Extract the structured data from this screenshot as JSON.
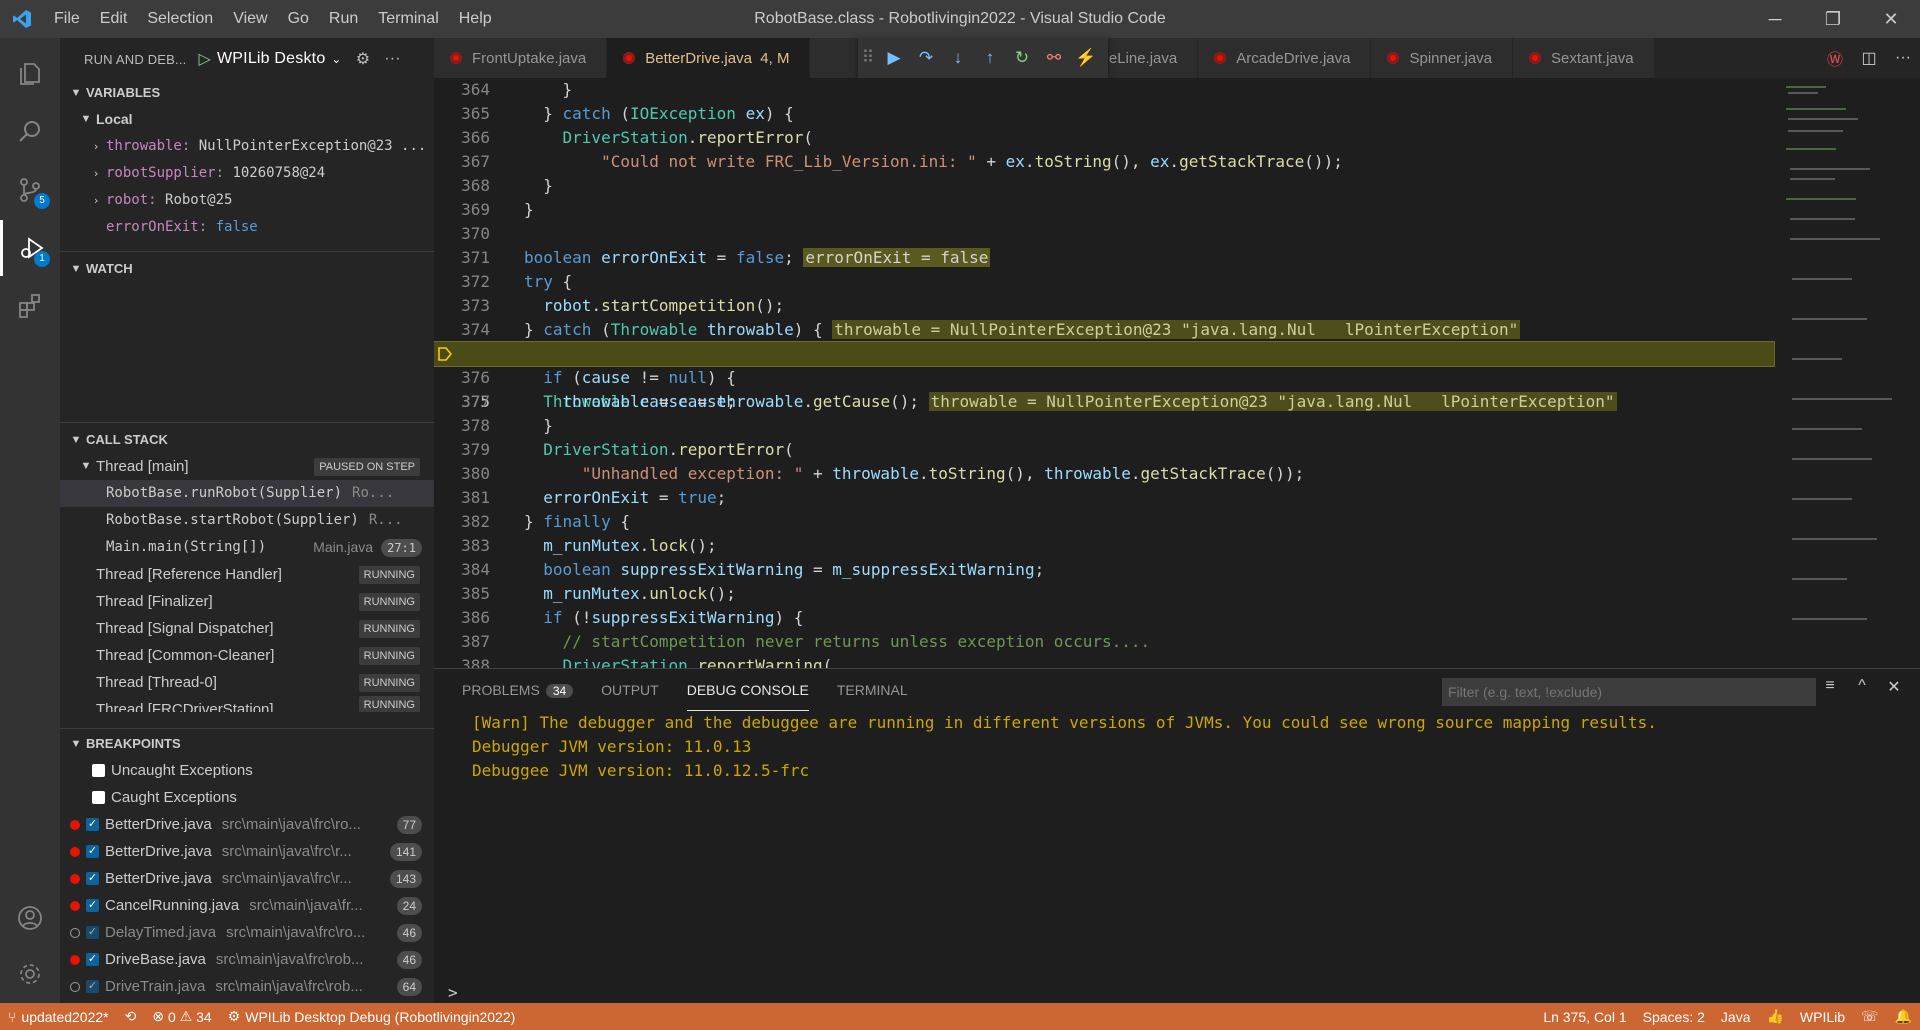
{
  "window": {
    "title": "RobotBase.class - Robotlivingin2022 - Visual Studio Code",
    "menu": [
      "File",
      "Edit",
      "Selection",
      "View",
      "Go",
      "Run",
      "Terminal",
      "Help"
    ],
    "controls": [
      "─",
      "❐",
      "✕"
    ]
  },
  "activity": {
    "scm_badge": "5",
    "debug_badge": "1"
  },
  "sidebar": {
    "title": "RUN AND DEB...",
    "config": "WPILib Deskto",
    "variables": {
      "header": "VARIABLES",
      "scope": "Local",
      "items": [
        {
          "name": "throwable:",
          "value": "NullPointerException@23 ..."
        },
        {
          "name": "robotSupplier:",
          "value": "10260758@24"
        },
        {
          "name": "robot:",
          "value": "Robot@25"
        },
        {
          "name": "errorOnExit:",
          "value": "false"
        }
      ]
    },
    "watch": {
      "header": "WATCH"
    },
    "callstack": {
      "header": "CALL STACK",
      "main_thread": "Thread [main]",
      "main_state": "PAUSED ON STEP",
      "frames": [
        {
          "name": "RobotBase.runRobot(Supplier)",
          "src": "Ro..."
        },
        {
          "name": "RobotBase.startRobot(Supplier)",
          "src": "R..."
        },
        {
          "name": "Main.main(String[])",
          "src": "Main.java",
          "pos": "27:1"
        }
      ],
      "threads": [
        {
          "name": "Thread [Reference Handler]",
          "state": "RUNNING"
        },
        {
          "name": "Thread [Finalizer]",
          "state": "RUNNING"
        },
        {
          "name": "Thread [Signal Dispatcher]",
          "state": "RUNNING"
        },
        {
          "name": "Thread [Common-Cleaner]",
          "state": "RUNNING"
        },
        {
          "name": "Thread [Thread-0]",
          "state": "RUNNING"
        },
        {
          "name": "Thread [FRCDriverStation]",
          "state": "RUNNING"
        }
      ]
    },
    "breakpoints": {
      "header": "BREAKPOINTS",
      "uncaught": "Uncaught Exceptions",
      "caught": "Caught Exceptions",
      "items": [
        {
          "file": "BetterDrive.java",
          "path": "src\\main\\java\\frc\\ro...",
          "line": "77",
          "on": true
        },
        {
          "file": "BetterDrive.java",
          "path": "src\\main\\java\\frc\\r...",
          "line": "141",
          "on": true
        },
        {
          "file": "BetterDrive.java",
          "path": "src\\main\\java\\frc\\r...",
          "line": "143",
          "on": true
        },
        {
          "file": "CancelRunning.java",
          "path": "src\\main\\java\\fr...",
          "line": "24",
          "on": true
        },
        {
          "file": "DelayTimed.java",
          "path": "src\\main\\java\\frc\\ro...",
          "line": "46",
          "on": false
        },
        {
          "file": "DriveBase.java",
          "path": "src\\main\\java\\frc\\rob...",
          "line": "46",
          "on": true
        },
        {
          "file": "DriveTrain.java",
          "path": "src\\main\\java\\frc\\rob...",
          "line": "64",
          "on": false
        }
      ]
    }
  },
  "tabs": [
    {
      "label": "FrontUptake.java"
    },
    {
      "label": "BetterDrive.java",
      "extra": "4, M"
    },
    {
      "label": "utoOnTheLine.java"
    },
    {
      "label": "ArcadeDrive.java"
    },
    {
      "label": "Spinner.java"
    },
    {
      "label": "Sextant.java"
    }
  ],
  "editor": {
    "lines": [
      "364",
      "365",
      "366",
      "367",
      "368",
      "369",
      "370",
      "371",
      "372",
      "373",
      "374",
      "375",
      "376",
      "377",
      "378",
      "379",
      "380",
      "381",
      "382",
      "383",
      "384",
      "385",
      "386",
      "387",
      "388"
    ],
    "inline_err": "errorOnExit = false",
    "inline_thr": "throwable = NullPointerException@23 \"java.lang.Nul   lPointerException\"",
    "str1": "\"Could not write FRC_Lib_Version.ini: \"",
    "str2": "\"Unhandled exception: \"",
    "comment": "// startCompetition never returns unless exception occurs...."
  },
  "panel": {
    "tabs": [
      "PROBLEMS",
      "OUTPUT",
      "DEBUG CONSOLE",
      "TERMINAL"
    ],
    "problems_count": "34",
    "filter_placeholder": "Filter (e.g. text, !exclude)",
    "output": [
      "[Warn] The debugger and the debuggee are running in different versions of JVMs. You could see wrong source mapping results.",
      "Debugger JVM version: 11.0.13",
      "Debuggee JVM version: 11.0.12.5-frc"
    ],
    "prompt": ">"
  },
  "status": {
    "branch": "updated2022*",
    "errors": "0",
    "warnings": "34",
    "debug": "WPILib Desktop Debug (Robotlivingin2022)",
    "position": "Ln 375, Col 1",
    "spaces": "Spaces: 2",
    "lang": "Java",
    "ext": "WPILib"
  },
  "colors": {
    "status_bar": "#cc6633",
    "current_line": "#4b4b18"
  }
}
